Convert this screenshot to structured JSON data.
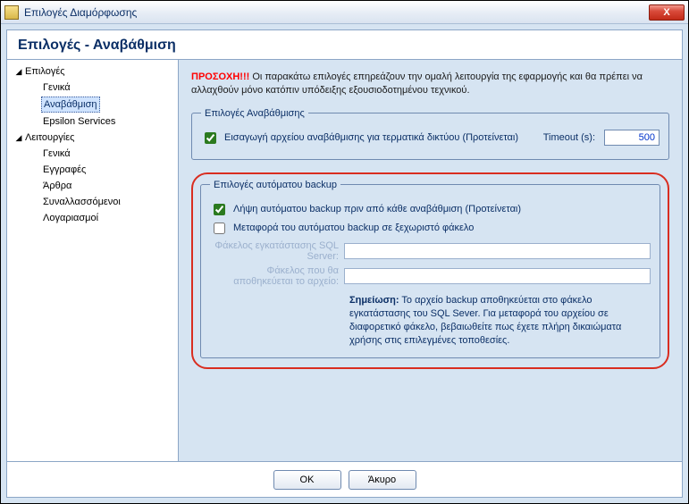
{
  "window": {
    "title": "Επιλογές Διαμόρφωσης",
    "close_glyph": "X"
  },
  "page_heading": "Επιλογές - Αναβάθμιση",
  "tree": {
    "root1": {
      "label": "Επιλογές",
      "caret": "◢"
    },
    "root1_items": [
      {
        "label": "Γενικά"
      },
      {
        "label": "Αναβάθμιση",
        "selected": true
      },
      {
        "label": "Epsilon Services"
      }
    ],
    "root2": {
      "label": "Λειτουργίες",
      "caret": "◢"
    },
    "root2_items": [
      {
        "label": "Γενικά"
      },
      {
        "label": "Εγγραφές"
      },
      {
        "label": "Άρθρα"
      },
      {
        "label": "Συναλλασσόμενοι"
      },
      {
        "label": "Λογαριασμοί"
      }
    ]
  },
  "warning": {
    "prefix": "ΠΡΟΣΟΧΗ!!!",
    "text": " Οι παρακάτω επιλογές επηρεάζουν την ομαλή λειτουργία της εφαρμογής και θα πρέπει να αλλαχθούν μόνο κατόπιν υπόδειξης εξουσιοδοτημένου τεχνικού."
  },
  "group_upgrade": {
    "legend": "Επιλογές Αναβάθμισης",
    "checkbox_label": "Εισαγωγή αρχείου αναβάθμισης για τερματικά δικτύου (Προτείνεται)",
    "checkbox_checked": true,
    "timeout_label": "Timeout (s):",
    "timeout_value": "500"
  },
  "group_backup": {
    "legend": "Επιλογές αυτόματου backup",
    "chk1_label": "Λήψη αυτόματου backup πριν από κάθε αναβάθμιση (Προτείνεται)",
    "chk1_checked": true,
    "chk2_label": "Μεταφορά του αυτόματου backup σε ξεχωριστό φάκελο",
    "chk2_checked": false,
    "field1_label": "Φάκελος εγκατάστασης SQL Server:",
    "field1_value": "",
    "field2_label": "Φάκελος που θα αποθηκεύεται το αρχείο:",
    "field2_value": "",
    "note_prefix": "Σημείωση:",
    "note_text": " Το αρχείο backup αποθηκεύεται στο φάκελο εγκατάστασης του SQL Sever. Για μεταφορά του αρχείου σε διαφορετικό φάκελο, βεβαιωθείτε πως έχετε πλήρη δικαιώματα χρήσης στις επιλεγμένες τοποθεσίες."
  },
  "footer": {
    "ok": "OK",
    "cancel": "Άκυρο"
  }
}
